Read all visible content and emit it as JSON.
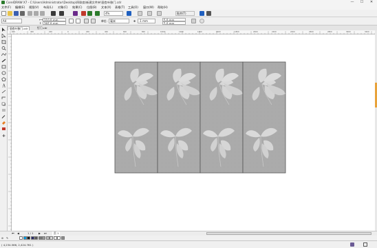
{
  "window": {
    "title": "CorelDRAW X7 - C:\\Users\\Administrator\\Desktop\\四联扇\\新建文件夹\\银杏叶移门.cdr",
    "minimize": "—",
    "maximize": "☐",
    "close": "✕"
  },
  "menu": [
    "文件(F)",
    "编辑(E)",
    "视图(V)",
    "布局(L)",
    "对象(C)",
    "效果(C)",
    "位图(B)",
    "文本(X)",
    "表格(T)",
    "工具(O)",
    "窗口(W)",
    "帮助(H)"
  ],
  "toolbar": {
    "zoom": "4%",
    "snap_label": "贴齐(T)",
    "colors": {
      "accent": "#1f5fbf",
      "green": "#2b7a2b",
      "purple": "#6a2a8a"
    }
  },
  "propbar": {
    "page_size": "A4",
    "width": "210.0 mm",
    "height": "297.0 mm",
    "units_label": "单位:",
    "units": "毫米",
    "nudge": ".1 mm",
    "dup_x": "5.0 mm",
    "dup_y": "5.0 mm"
  },
  "tabs": [
    {
      "label": "银杏叶移门.cdr",
      "active": true
    },
    {
      "label": "钉门.cdr",
      "active": false
    }
  ],
  "ruler": {
    "h_ticks": [
      "600",
      "400",
      "200",
      "0",
      "200",
      "400",
      "600",
      "800",
      "1000",
      "1200",
      "1400",
      "1600",
      "1800",
      "2000",
      "2200",
      "2400",
      "2600",
      "2800",
      "3000",
      "3200"
    ],
    "units": "毫米"
  },
  "artwork": {
    "panels": 4,
    "panel_color": "#a9a9a9",
    "leaf_color": "#d6d6d6",
    "border_color": "#555555"
  },
  "pagenav": {
    "counter": "1 / 1",
    "page_tab": "页 1"
  },
  "palette": {
    "colors": [
      "#ffffff",
      "#00a0e9",
      "#1a1a1a",
      "#2a2a6a",
      "#5a5a5a",
      "#7a7a7a",
      "#9a9a9a",
      "#bababa",
      "#dadada",
      "#f0f0f0",
      "#ffffff",
      "#8c8c8c"
    ]
  },
  "status": {
    "coords": "( 4,234.566, 2,424.761 )",
    "fill_icon": "fill-icon",
    "outline_icon": "outline-icon"
  }
}
